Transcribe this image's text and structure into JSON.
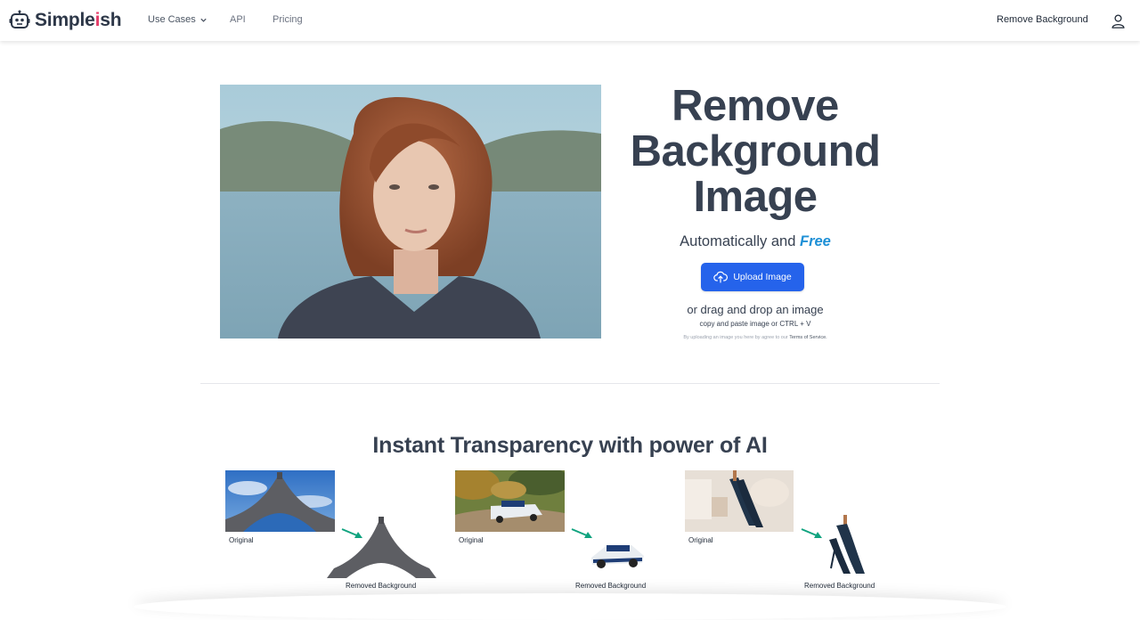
{
  "nav": {
    "logo_prefix": "Simple",
    "logo_accent": "i",
    "logo_suffix": "sh",
    "links": [
      {
        "label": "Use Cases",
        "dropdown": true
      },
      {
        "label": "API"
      },
      {
        "label": "Pricing"
      }
    ],
    "right_link": "Remove Background",
    "icons": {
      "logo": "robot-icon",
      "user": "user-icon",
      "chevron": "chevron-down-icon"
    }
  },
  "hero": {
    "title_line1": "Remove",
    "title_line2": "Background",
    "title_line3": "Image",
    "subtitle_main": "Automatically and",
    "subtitle_accent": "Free",
    "upload_label": "Upload Image",
    "drag_text": "or drag and drop an image",
    "paste_text": "copy and paste image or CTRL + V",
    "terms_text": "By uploading an image you here by agree to our",
    "terms_link": "Terms of Service.",
    "accent_color": "#1e90d6",
    "button_color": "#2563eb"
  },
  "section": {
    "title": "Instant Transparency with power of AI",
    "examples": [
      {
        "subject": "eiffel-tower",
        "original_label": "Original",
        "result_label": "Removed Background"
      },
      {
        "subject": "rally-car",
        "original_label": "Original",
        "result_label": "Removed Background"
      },
      {
        "subject": "high-heels",
        "original_label": "Original",
        "result_label": "Removed Background"
      }
    ],
    "arrow_color": "#10a37f"
  }
}
